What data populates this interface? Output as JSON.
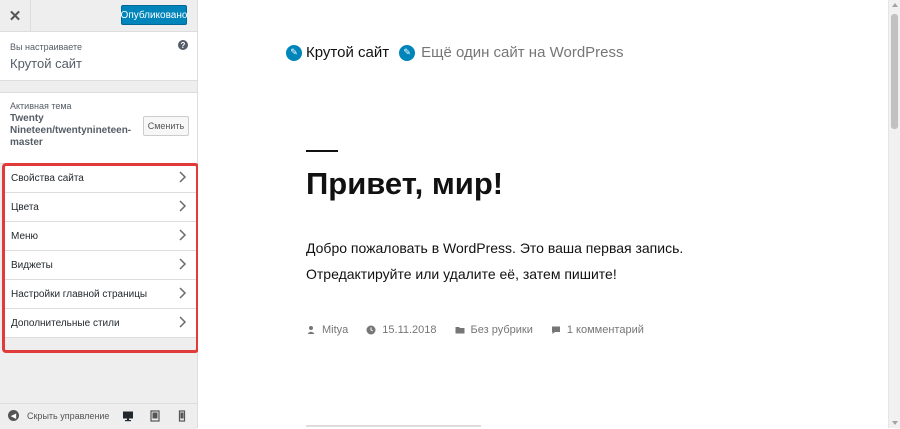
{
  "sidebar": {
    "close_icon": "close-icon",
    "publish_label": "Опубликовано",
    "info": {
      "label": "Вы настраиваете",
      "site_name": "Крутой сайт",
      "help_icon": "?"
    },
    "theme": {
      "label": "Активная тема",
      "name": "Twenty Nineteen/twentynineteen-master",
      "change_label": "Сменить"
    },
    "panels": [
      {
        "label": "Свойства сайта"
      },
      {
        "label": "Цвета"
      },
      {
        "label": "Меню"
      },
      {
        "label": "Виджеты"
      },
      {
        "label": "Настройки главной страницы"
      },
      {
        "label": "Дополнительные стили"
      }
    ],
    "footer": {
      "collapse_label": "Скрыть управление"
    }
  },
  "preview": {
    "site_title": "Крутой сайт",
    "site_description": "Ещё один сайт на WordPress",
    "post_title": "Привет, мир!",
    "excerpt": "Добро пожаловать в WordPress. Это ваша первая запись. Отредактируйте или удалите её, затем пишите!",
    "meta": {
      "author": "Mitya",
      "date": "15.11.2018",
      "category": "Без рубрики",
      "comments": "1 комментарий"
    }
  },
  "colors": {
    "accent": "#0085ba",
    "highlight": "#e03a3a"
  }
}
